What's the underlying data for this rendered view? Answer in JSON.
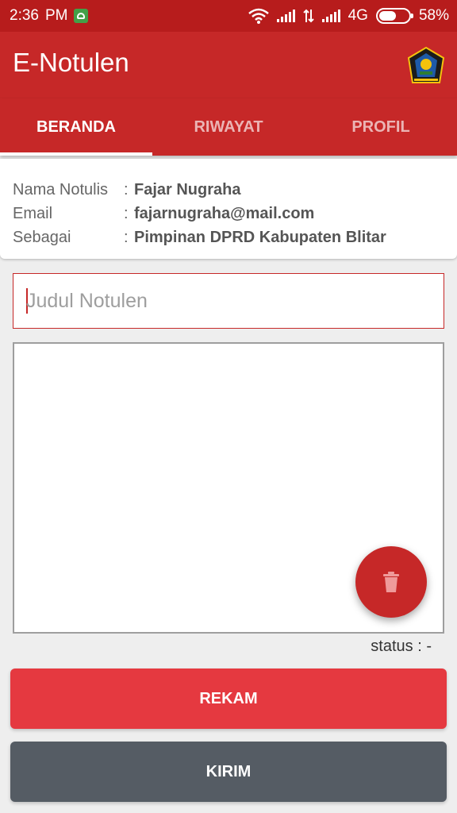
{
  "status_bar": {
    "time": "2:36",
    "ampm": "PM",
    "network": "4G",
    "battery": "58%",
    "battery_level": 0.58
  },
  "app_bar": {
    "title": "E-Notulen",
    "logo_icon": "regency-emblem-icon"
  },
  "tabs": [
    {
      "label": "BERANDA",
      "active": true
    },
    {
      "label": "RIWAYAT",
      "active": false
    },
    {
      "label": "PROFIL",
      "active": false
    }
  ],
  "info": {
    "name_label": "Nama Notulis",
    "name_value": "Fajar Nugraha",
    "email_label": "Email",
    "email_value": "fajarnugraha@mail.com",
    "role_label": "Sebagai",
    "role_value": "Pimpinan DPRD Kabupaten Blitar",
    "separator": ":"
  },
  "form": {
    "title_placeholder": "Judul Notulen",
    "title_value": "",
    "content_value": "",
    "status_text": "status : -"
  },
  "buttons": {
    "record_label": "REKAM",
    "send_label": "KIRIM",
    "delete_icon": "trash-icon"
  },
  "colors": {
    "primary": "#c62828",
    "status_bar": "#b71c1c",
    "record_button": "#e53940",
    "send_button": "#555c64"
  }
}
